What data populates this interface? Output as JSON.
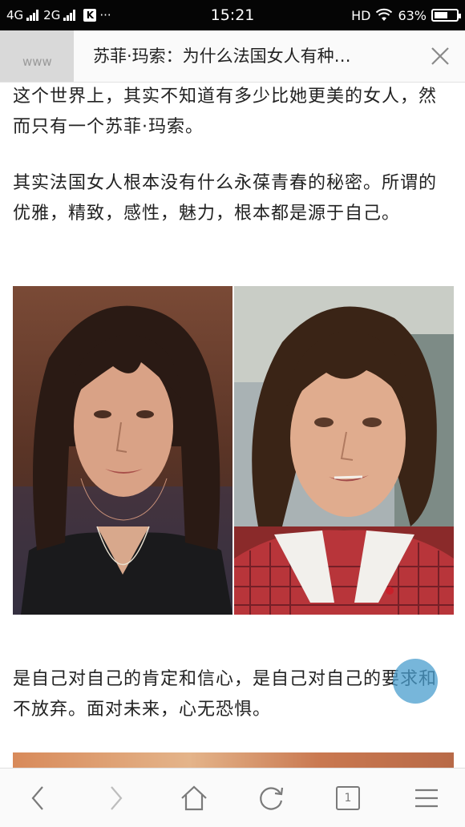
{
  "status_bar": {
    "network1": "4G",
    "network2": "2G",
    "app_badge": "K",
    "more": "···",
    "time": "15:21",
    "hd": "HD",
    "battery_text": "63%",
    "battery_level": 0.63
  },
  "title_bar": {
    "ghost_text": "www",
    "title": "苏菲·玛索：为什么法国女人有种…"
  },
  "article": {
    "paragraph1": "这个世界上，其实不知道有多少比她更美的女人，然而只有一个苏菲·玛索。",
    "paragraph2": "其实法国女人根本没有什么永葆青春的秘密。所谓的优雅，精致，感性，魅力，根本都是源于自己。",
    "paragraph3": "是自己对自己的肯定和信心，是自己对自己的要求和不放弃。面对未来，心无恐惧。"
  },
  "bottom_nav": {
    "tab_count": "1",
    "icons": [
      "back-icon",
      "forward-icon",
      "home-icon",
      "refresh-icon",
      "tabs-icon",
      "menu-icon"
    ]
  },
  "colors": {
    "status_bg": "#050505",
    "tap_highlight": "#499ece",
    "text": "#222222",
    "icon": "#7a7a7a"
  }
}
